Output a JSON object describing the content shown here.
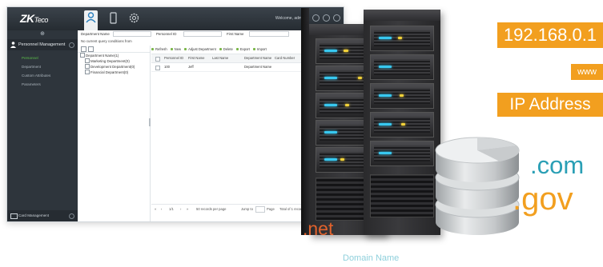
{
  "app": {
    "logo_main": "ZK",
    "logo_sub": "Teco",
    "welcome": "Welcome, admin",
    "sidebar": {
      "module": "Personnel Management",
      "items": [
        {
          "label": "Personnel",
          "selected": true
        },
        {
          "label": "Department",
          "selected": false
        },
        {
          "label": "Custom Attributes",
          "selected": false
        },
        {
          "label": "Parameters",
          "selected": false
        }
      ],
      "footer": "Card Management"
    },
    "filters": {
      "department_name": "Department Name",
      "personnel_id": "Personnel ID",
      "first_name": "First Name"
    },
    "conditions_text": "No current query conditions from",
    "tree": [
      {
        "label": "Department Name(1)",
        "indent": 0
      },
      {
        "label": "Marketing Department(0)",
        "indent": 1
      },
      {
        "label": "Development Department(0)",
        "indent": 1
      },
      {
        "label": "Financial Department(0)",
        "indent": 1
      }
    ],
    "toolbar": [
      "Refresh",
      "New",
      "Adjust Department",
      "Delete",
      "Export",
      "Import"
    ],
    "columns": [
      "Personnel ID",
      "First Name",
      "Last Name",
      "Department Name",
      "Card Number"
    ],
    "rows": [
      {
        "id": "100",
        "first_name": "Jeff",
        "last_name": "",
        "department": "Department Name",
        "card": ""
      }
    ],
    "pager": {
      "page": "1/1",
      "per_page": "50 records per page",
      "jump": "Jump to",
      "page_word": "Page",
      "total": "Total of 1 records"
    },
    "accent_color": "#5cbf4a"
  },
  "labels": {
    "ip": "192.168.0.1",
    "www": "www",
    "ip_address": "IP Address",
    "com": ".com",
    "gov": ".gov",
    "net": ".net",
    "domain_name": "Domain Name"
  },
  "colors": {
    "orange": "#f29f1f",
    "teal": "#2a9fb5",
    "red_orange": "#e1622c",
    "light_teal": "#8fd0dc"
  }
}
